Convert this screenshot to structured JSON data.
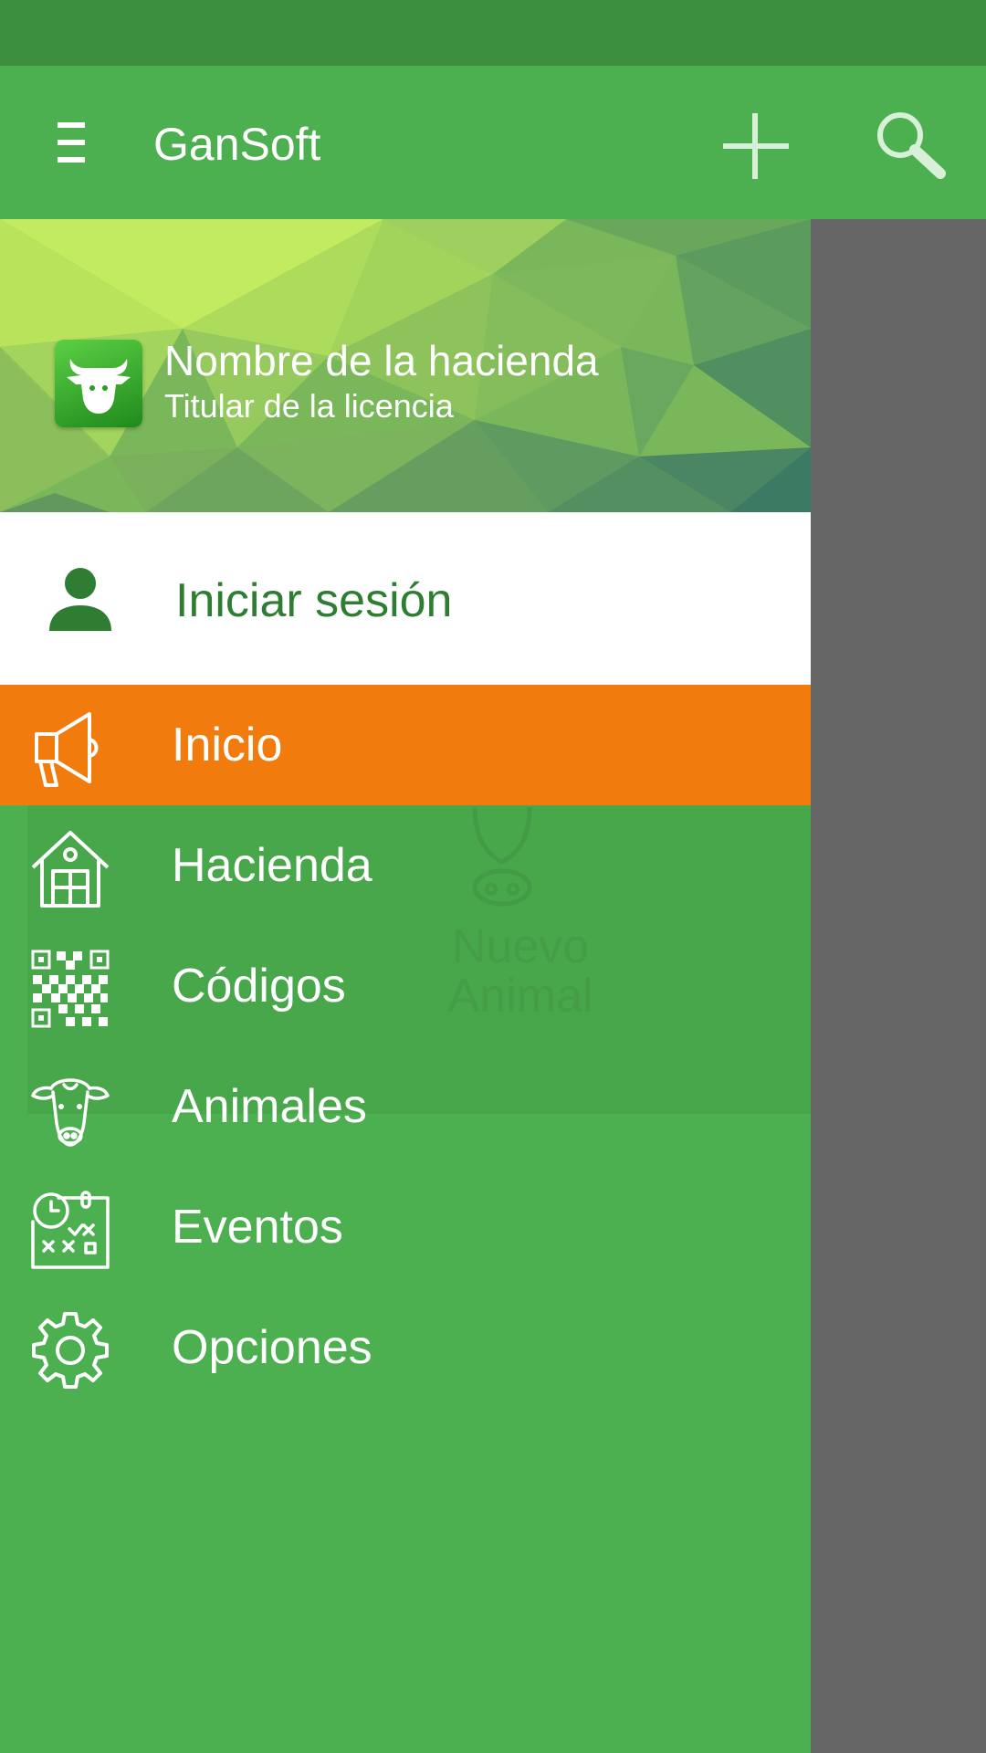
{
  "appbar": {
    "title": "GanSoft",
    "menu_icon": "hamburger-icon",
    "add_icon": "plus-icon",
    "search_icon": "search-icon"
  },
  "drawer": {
    "header": {
      "farm_name": "Nombre de la hacienda",
      "license_holder": "Titular de la licencia",
      "logo_icon": "bull-head-icon"
    },
    "login": {
      "label": "Iniciar sesión",
      "icon": "person-icon"
    },
    "items": [
      {
        "label": "Inicio",
        "icon": "megaphone-icon",
        "active": true
      },
      {
        "label": "Hacienda",
        "icon": "barn-icon",
        "active": false
      },
      {
        "label": "Códigos",
        "icon": "qr-code-icon",
        "active": false
      },
      {
        "label": "Animales",
        "icon": "cow-icon",
        "active": false
      },
      {
        "label": "Eventos",
        "icon": "calendar-events-icon",
        "active": false
      },
      {
        "label": "Opciones",
        "icon": "gear-icon",
        "active": false
      }
    ]
  },
  "background": {
    "button_label": "Nuevo Animal"
  },
  "colors": {
    "statusbar": "#3b8f3e",
    "primary": "#4caf50",
    "active_item": "#f27b0d",
    "login_text": "#2e7d32",
    "scrim": "#666666"
  }
}
